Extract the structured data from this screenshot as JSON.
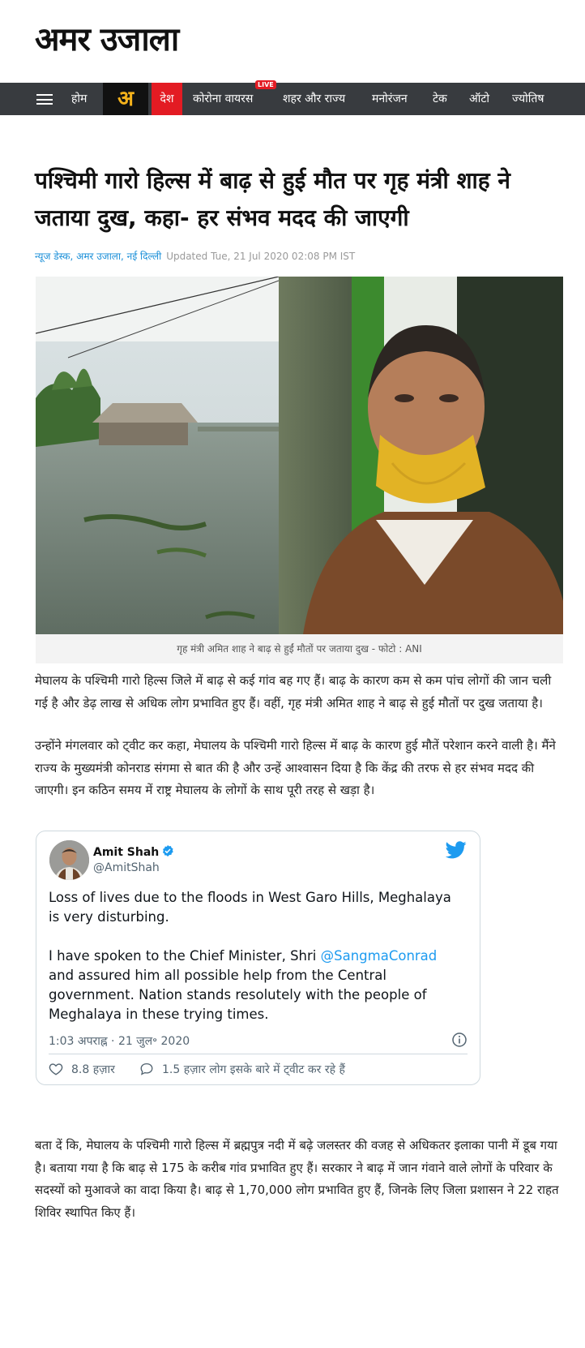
{
  "header": {
    "logo_text": "अमर उजाला"
  },
  "nav": {
    "items": [
      "होम",
      "देश",
      "कोरोना वायरस",
      "शहर और राज्य",
      "मनोरंजन",
      "टेक",
      "ऑटो",
      "ज्योतिष"
    ],
    "brand_badge": "अ",
    "live_badge": "LIVE"
  },
  "article": {
    "title": "पश्चिमी गारो हिल्स में बाढ़ से हुई मौत पर गृह मंत्री शाह ने जताया दुख, कहा- हर संभव मदद की जाएगी",
    "byline": "न्यूज डेस्क, अमर उजाला, नई दिल्ली",
    "updated": "Updated Tue, 21 Jul 2020 02:08 PM IST",
    "caption": "गृह मंत्री अमित शाह ने बाढ़ से हुईं मौतों पर जताया दुख - फोटो : ANI",
    "paragraphs": [
      "मेघालय के पश्चिमी गारो हिल्स जिले में बाढ़ से कई गांव बह गए हैं। बाढ़ के कारण कम से कम पांच लोगों की जान चली गई है और डेढ़ लाख से अधिक लोग प्रभावित हुए हैं। वहीं, गृह मंत्री अमित शाह ने बाढ़ से हुई मौतों पर दुख जताया है।",
      "उन्होंने मंगलवार को ट्वीट कर कहा, मेघालय के पश्चिमी गारो हिल्स में बाढ़ के कारण हुई मौतें परेशान करने वाली है। मैंने राज्य के मुख्यमंत्री कोनराड संगमा से बात की है और उन्हें आश्वासन दिया है कि केंद्र की तरफ से हर संभव मदद की जाएगी। इन कठिन समय में राष्ट्र मेघालय के लोगों के साथ पूरी तरह से खड़ा है।",
      "बता दें कि, मेघालय के पश्चिमी गारो हिल्स में ब्रह्मपुत्र नदी में बढ़े जलस्तर की वजह से अधिकतर इलाका पानी में डूब गया है। बताया गया है कि बाढ़ से 175 के करीब गांव प्रभावित हुए हैं। सरकार ने बाढ़ में जान गंवाने वाले लोगों के परिवार के सदस्यों को मुआवजे का वादा किया है। बाढ़ से 1,70,000 लोग प्रभावित हुए हैं, जिनके लिए जिला प्रशासन ने 22 राहत शिविर स्थापित किए हैं।"
    ]
  },
  "tweet": {
    "name": "Amit Shah",
    "handle": "@AmitShah",
    "text_line1": "Loss of lives due to the floods in West Garo Hills, Meghalaya is very disturbing.",
    "text_pre": "I have spoken to the Chief Minister, Shri ",
    "mention": "@SangmaConrad",
    "text_post": " and assured him all possible help from the Central government. Nation stands resolutely with the people of Meghalaya in these trying times.",
    "timestamp": "1:03 अपराह्न · 21 जुल॰ 2020",
    "likes": "8.8 हज़ार",
    "replies": "1.5 हज़ार लोग इसके बारे में ट्वीट कर रहे हैं"
  },
  "colors": {
    "nav_bg": "#383b3f",
    "accent_red": "#e31b23",
    "link_blue": "#1a8fd8",
    "twitter_blue": "#1d9bf0"
  }
}
